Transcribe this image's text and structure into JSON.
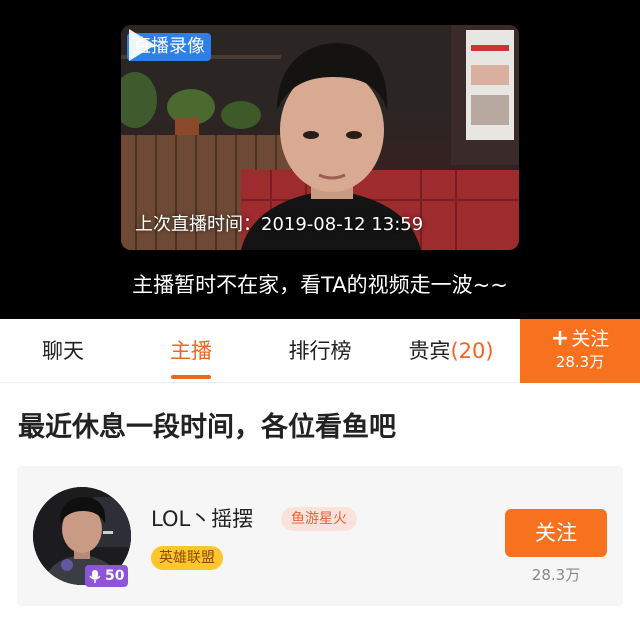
{
  "video": {
    "badge": "直播录像",
    "last_live": "上次直播时间：2019-08-12 13:59",
    "away_message": "主播暂时不在家，看TA的视频走一波~~"
  },
  "tabs": [
    {
      "label": "聊天",
      "active": false
    },
    {
      "label": "主播",
      "active": true
    },
    {
      "label": "排行榜",
      "active": false
    },
    {
      "label": "贵宾",
      "count": "(20)",
      "active": false
    }
  ],
  "follow_tab": {
    "label": "关注",
    "plus": "+",
    "count": "28.3万"
  },
  "notice": "最近休息一段时间，各位看鱼吧",
  "streamer": {
    "name": "LOL丶摇摆",
    "fan_badge": "鱼游星火",
    "game": "英雄联盟",
    "level": "50",
    "follow_label": "关注",
    "follower_count": "28.3万"
  },
  "colors": {
    "accent": "#f7711f",
    "replay_badge": "#2f7fe8",
    "level_badge": "#8f55d8",
    "game_badge": "#ffc62b"
  }
}
